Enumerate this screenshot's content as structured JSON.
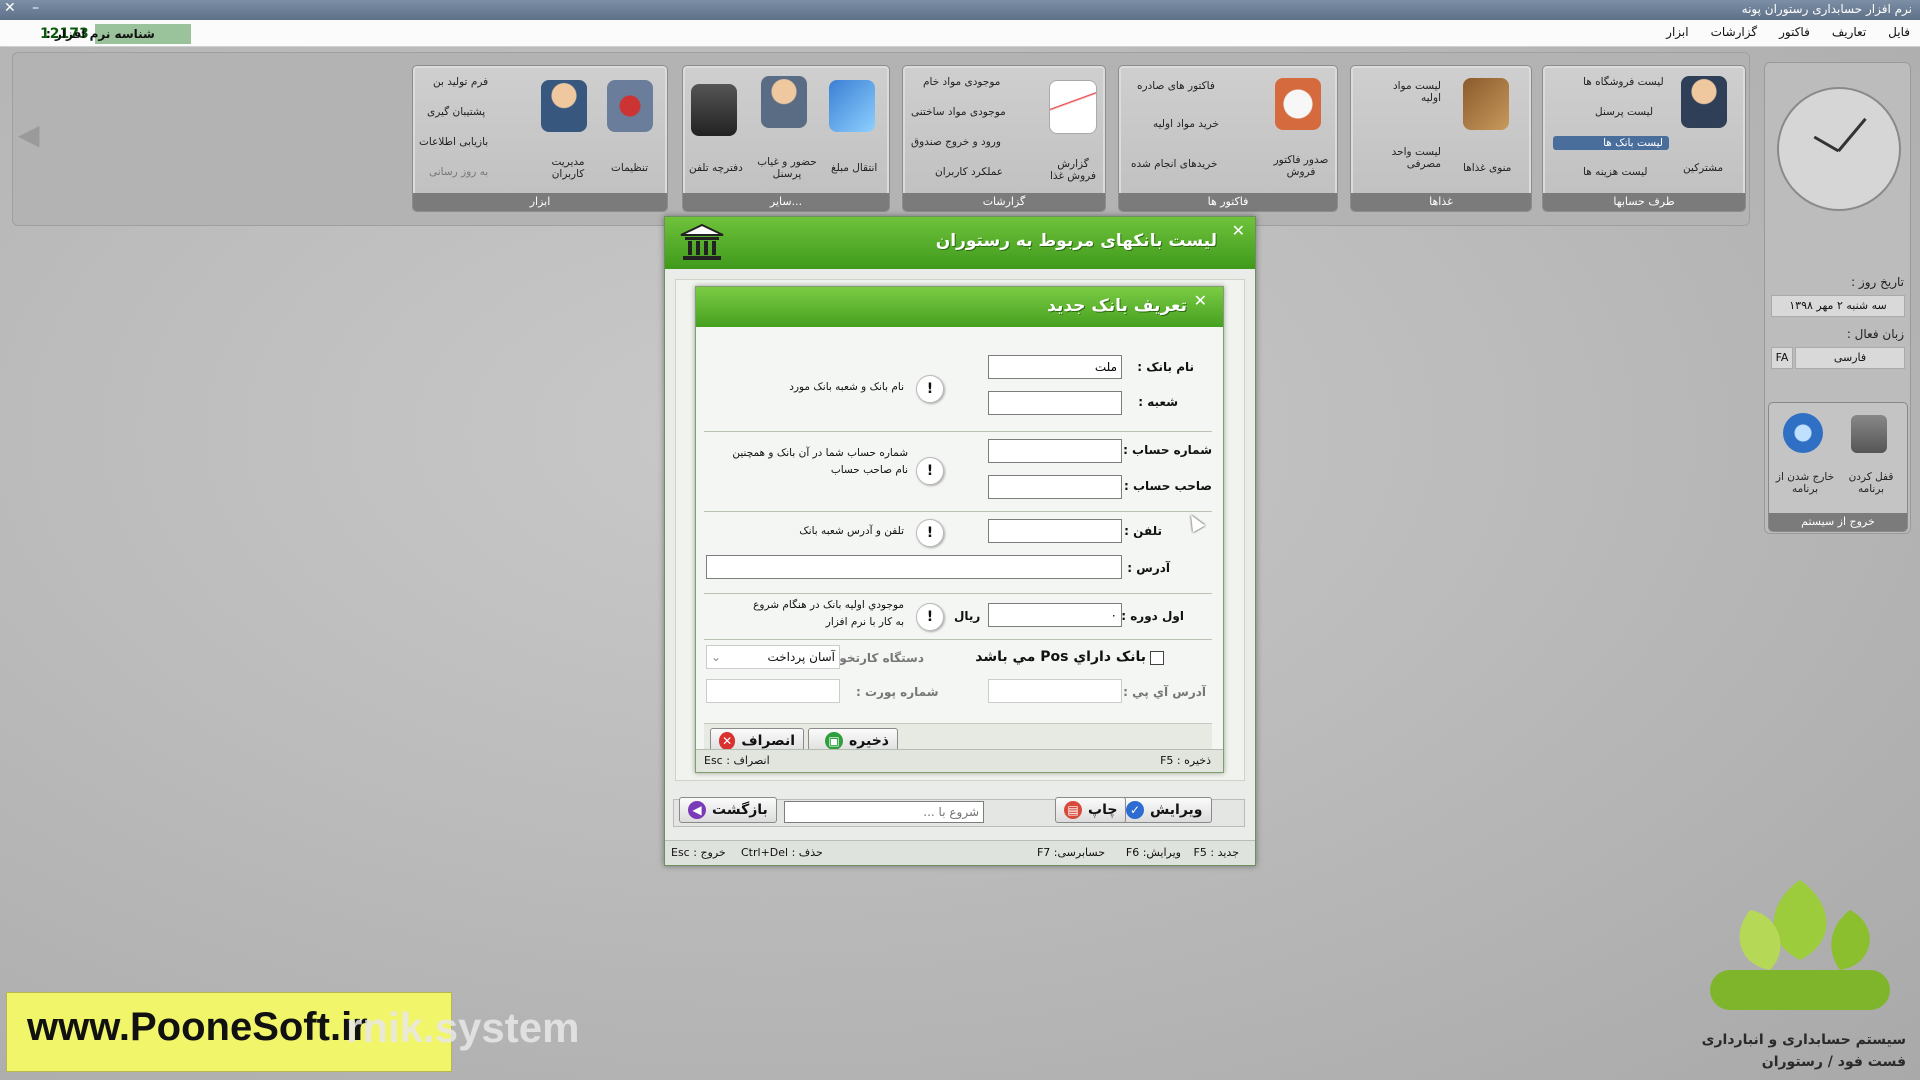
{
  "window": {
    "title": "نرم افزار حسابداری رستوران پونه"
  },
  "menubar": {
    "items": [
      "فایل",
      "تعاریف",
      "فاکتور",
      "گزارشات",
      "ابزار"
    ],
    "license_label": "شناسه نرم افزار :",
    "license_number": "12173"
  },
  "ribbon": {
    "groups": [
      {
        "title": "طرف حسابها",
        "big": "مشترکین",
        "items": [
          "لیست فروشگاه ها",
          "لیست پرسنل",
          "لیست بانک ها",
          "لیست هزینه ها"
        ]
      },
      {
        "title": "غذاها",
        "big": "منوی غذاها",
        "items": [
          "لیست مواد اولیه",
          "لیست واحد مصرفی"
        ]
      },
      {
        "title": "فاکتور ها",
        "big": "صدور فاکتور فروش",
        "items": [
          "فاکتور های صادره",
          "خرید مواد اولیه",
          "خریدهای انجام شده"
        ]
      },
      {
        "title": "گزارشات",
        "big": "گزارش فروش غذا",
        "items": [
          "موجودی مواد خام",
          "موجودی مواد ساختنی",
          "ورود و خروج صندوق",
          "عملکرد کاربران"
        ]
      },
      {
        "title": "سایر...",
        "items": [
          "انتقال مبلغ",
          "حضور و غیاب پرسنل",
          "دفترچه تلفن"
        ]
      },
      {
        "title": "ابزار",
        "items": [
          "تنظیمات",
          "مدیریت کاربران",
          "فرم تولید بن",
          "پشتیبان گیری",
          "بازیابی اطلاعات",
          "به روز رسانی"
        ]
      }
    ]
  },
  "sidepanel": {
    "date_label": "تاریخ روز :",
    "date_value": "سه شنبه ۲ مهر ۱۳۹۸",
    "lang_label": "زبان فعال :",
    "lang_code": "FA",
    "lang_value": "فارسی",
    "exit_group_title": "خروج از سیستم",
    "logout_label": "خارج شدن از برنامه",
    "lock_label": "قفل کردن برنامه"
  },
  "outer_dialog": {
    "title": "لیست بانکهای مربوط به رستوران",
    "search_placeholder": "شروع با ...",
    "buttons": {
      "edit": "ویرایش",
      "print": "چاپ",
      "back": "بازگشت"
    },
    "status": {
      "new": "F5 : جدید",
      "edit": "F6 :ویرایش",
      "audit": "F7 :حسابرسی",
      "delete": "Ctrl+Del : حذف",
      "exit": "Esc : خروج"
    }
  },
  "inner_dialog": {
    "title": "تعریف بانک جدید",
    "fields": {
      "bank_name_label": "نام بانک :",
      "bank_name_value": "ملت",
      "branch_label": "شعبه :",
      "branch_value": "",
      "hint_bank": "نام بانک و شعبه بانک مورد",
      "account_number_label": "شماره حساب :",
      "account_number_value": "",
      "account_owner_label": "صاحب حساب :",
      "account_owner_value": "",
      "hint_account": "شماره حساب شما در آن بانک و همچنین نام صاحب حساب",
      "phone_label": "تلفن :",
      "phone_value": "",
      "hint_phone": "تلفن و آدرس شعبه بانک",
      "address_label": "آدرس :",
      "address_value": "",
      "opening_label": "اول دوره :",
      "opening_value": "۰",
      "currency": "ریال",
      "hint_opening": "موجودي اوليه بانک در هنگام شروع به کار با نرم افزار",
      "pos_checkbox_label": "بانک داراي Pos مي باشد",
      "card_reader_label": "دستگاه کارتخوان :",
      "card_reader_value": "آسان پرداخت",
      "ip_label": "آدرس آي پي :",
      "ip_value": "",
      "port_label": "شماره پورت :",
      "port_value": ""
    },
    "buttons": {
      "save": "ذخیره",
      "cancel": "انصراف"
    },
    "status": {
      "save": "F5 : ذخیره",
      "cancel": "Esc : انصراف"
    }
  },
  "branding": {
    "website": "www.PooneSoft.ir",
    "overlay": "rnik.system",
    "logo_line1": "سیستم حسابداری و انبارداری",
    "logo_line2": "فست فود / رستوران"
  },
  "colors": {
    "header_green": "#4fa82a",
    "accent_blue": "#4a6e9c",
    "watermark_yellow": "#f1f56a"
  }
}
